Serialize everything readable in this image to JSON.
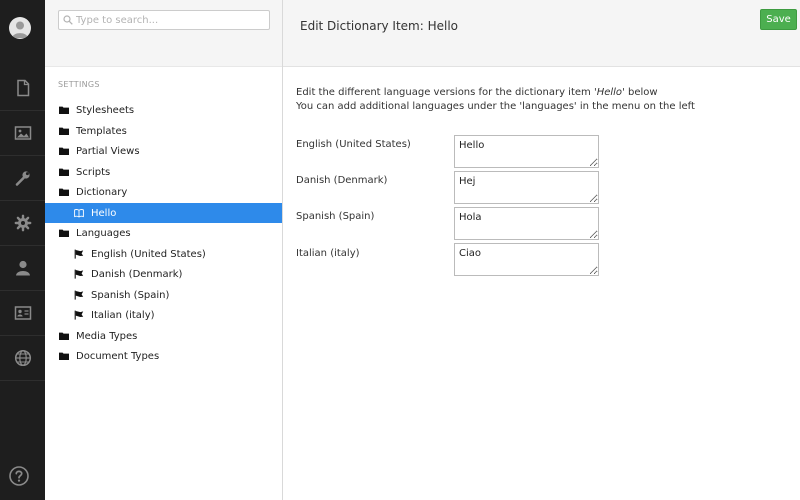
{
  "colors": {
    "rail": "#1e1e1e",
    "active": "#2e8aea",
    "save": "#4caf50"
  },
  "rail": {
    "items": [
      {
        "name": "content",
        "icon": "document-icon"
      },
      {
        "name": "media",
        "icon": "image-icon"
      },
      {
        "name": "settings",
        "icon": "wrench-icon"
      },
      {
        "name": "developer",
        "icon": "gear-icon"
      },
      {
        "name": "users",
        "icon": "user-icon"
      },
      {
        "name": "members",
        "icon": "id-card-icon"
      },
      {
        "name": "translation",
        "icon": "globe-icon"
      }
    ],
    "help_icon": "help-icon",
    "avatar_icon": "avatar-icon"
  },
  "tree": {
    "search_placeholder": "Type to search...",
    "section_title": "SETTINGS",
    "nodes": [
      {
        "label": "Stylesheets",
        "icon": "folder-icon",
        "level": 0
      },
      {
        "label": "Templates",
        "icon": "folder-icon",
        "level": 0
      },
      {
        "label": "Partial Views",
        "icon": "folder-icon",
        "level": 0
      },
      {
        "label": "Scripts",
        "icon": "folder-icon",
        "level": 0
      },
      {
        "label": "Dictionary",
        "icon": "folder-icon",
        "level": 0
      },
      {
        "label": "Hello",
        "icon": "book-icon",
        "level": 1,
        "active": true
      },
      {
        "label": "Languages",
        "icon": "folder-icon",
        "level": 0
      },
      {
        "label": "English (United States)",
        "icon": "flag-icon",
        "level": 1
      },
      {
        "label": "Danish (Denmark)",
        "icon": "flag-icon",
        "level": 1
      },
      {
        "label": "Spanish (Spain)",
        "icon": "flag-icon",
        "level": 1
      },
      {
        "label": "Italian (italy)",
        "icon": "flag-icon",
        "level": 1
      },
      {
        "label": "Media Types",
        "icon": "folder-icon",
        "level": 0
      },
      {
        "label": "Document Types",
        "icon": "folder-icon",
        "level": 0
      }
    ]
  },
  "main": {
    "title": "Edit Dictionary Item: Hello",
    "save_label": "Save",
    "desc_line1_pre": "Edit the different language versions for the dictionary item '",
    "desc_line1_item": "Hello",
    "desc_line1_post": "' below",
    "desc_line2": "You can add additional languages under the 'languages' in the menu on the left",
    "languages": [
      {
        "label": "English (United States)",
        "value": "Hello"
      },
      {
        "label": "Danish (Denmark)",
        "value": "Hej"
      },
      {
        "label": "Spanish (Spain)",
        "value": "Hola"
      },
      {
        "label": "Italian (italy)",
        "value": "Ciao"
      }
    ]
  }
}
